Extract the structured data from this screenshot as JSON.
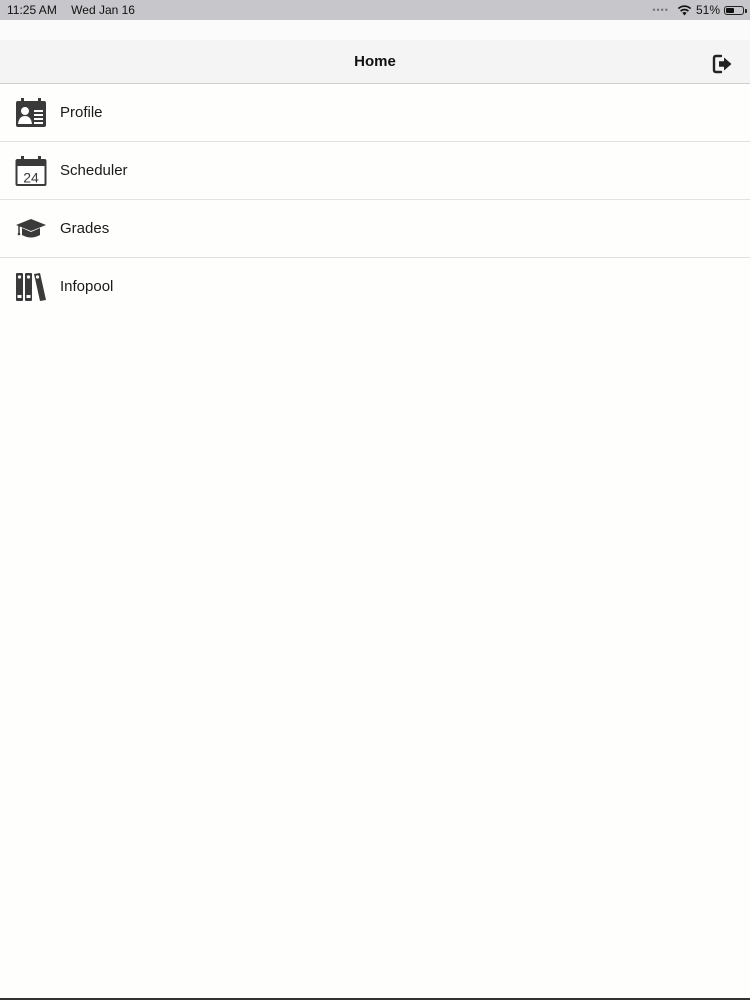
{
  "status_bar": {
    "time": "11:25 AM",
    "date": "Wed Jan 16",
    "battery": "51%",
    "battery_level": 0.51,
    "icons": [
      "wifi-icon",
      "battery-icon"
    ]
  },
  "header": {
    "title": "Home",
    "logout_icon": "logout-icon"
  },
  "menu": {
    "items": [
      {
        "label": "Profile",
        "icon": "profile-card-icon"
      },
      {
        "label": "Scheduler",
        "icon": "calendar-icon"
      },
      {
        "label": "Grades",
        "icon": "graduation-cap-icon"
      },
      {
        "label": "Infopool",
        "icon": "binders-icon"
      }
    ]
  },
  "colors": {
    "icon": "#3a3a3a",
    "divider": "#e2e2e2",
    "status_bar_bg": "#c7c7cb"
  }
}
